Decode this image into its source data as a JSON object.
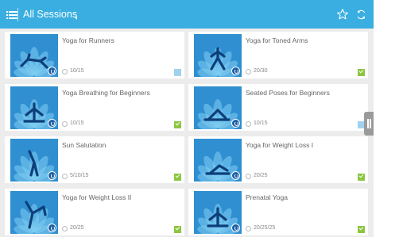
{
  "app": {
    "header_title": "All Sessions",
    "accent_color": "#3aaee0",
    "icons": {
      "menu": "menu-icon",
      "favorite": "star-icon",
      "sync": "sync-icon"
    }
  },
  "sessions": [
    {
      "title": "Yoga for Runners",
      "count": "10/15",
      "status": "partial",
      "pose": "plank"
    },
    {
      "title": "Yoga for Toned Arms",
      "count": "20/30",
      "status": "done",
      "pose": "kneeling"
    },
    {
      "title": "Yoga Breathing for Beginners",
      "count": "10/15",
      "status": "done",
      "pose": "seated"
    },
    {
      "title": "Seated Poses for Beginners",
      "count": "10/15",
      "status": "partial",
      "pose": "forward-fold"
    },
    {
      "title": "Sun Salutation",
      "count": "5/10/15",
      "status": "done",
      "pose": "backbend"
    },
    {
      "title": "Yoga for Weight Loss I",
      "count": "20/25",
      "status": "done",
      "pose": "child"
    },
    {
      "title": "Yoga for Weight Loss II",
      "count": "20/25",
      "status": "done",
      "pose": "dancer"
    },
    {
      "title": "Prenatal Yoga",
      "count": "20/25/25",
      "status": "done",
      "pose": "seated"
    }
  ]
}
